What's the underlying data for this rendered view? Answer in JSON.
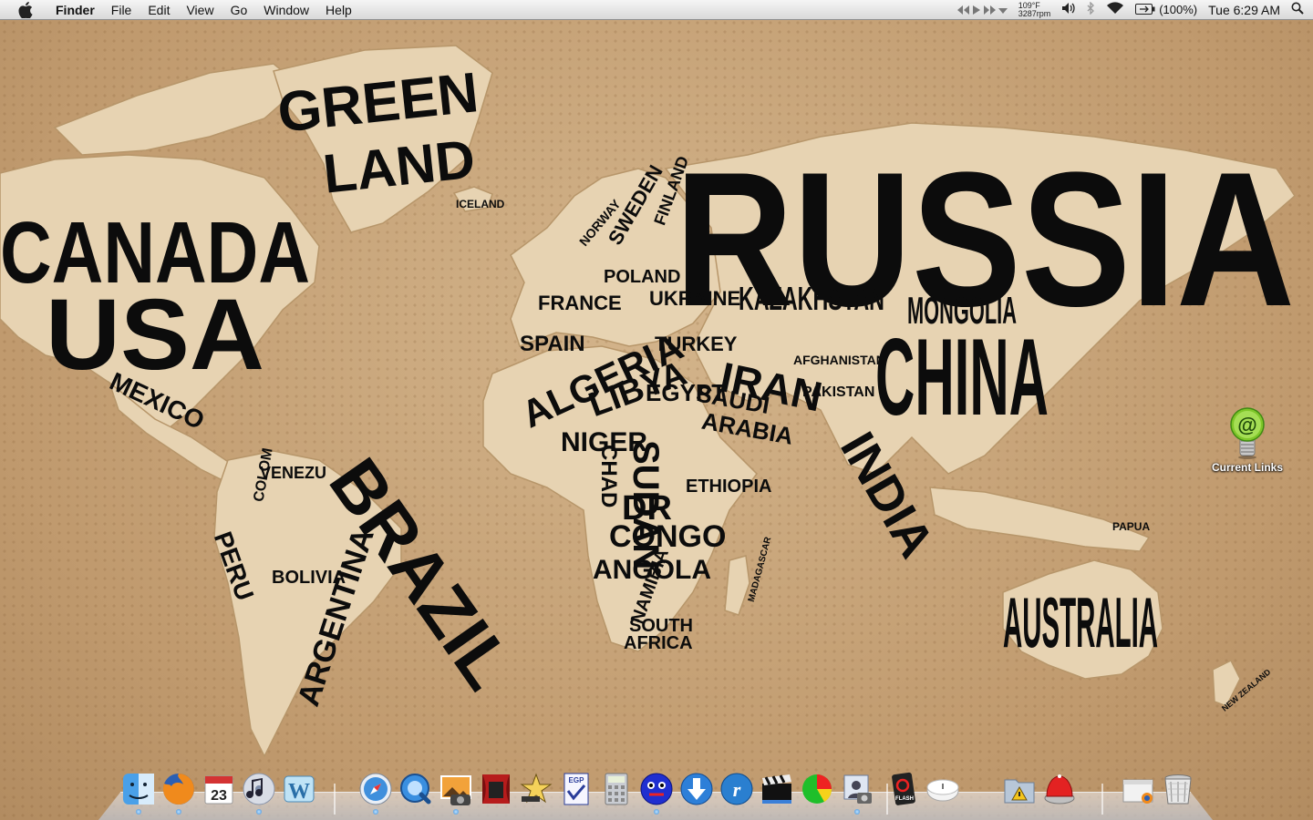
{
  "menubar": {
    "app_name": "Finder",
    "menus": [
      "File",
      "Edit",
      "View",
      "Go",
      "Window",
      "Help"
    ],
    "status": {
      "temperature": "109°F",
      "fan_speed": "3287rpm",
      "battery_percent": "(100%)",
      "clock": "Tue 6:29 AM"
    }
  },
  "map": {
    "labels": {
      "greenland_1": "GREEN",
      "greenland_2": "LAND",
      "canada": "CANADA",
      "usa": "USA",
      "mexico": "MEXICO",
      "iceland": "ICELAND",
      "russia": "RUSSIA",
      "china": "CHINA",
      "mongolia": "MONGOLIA",
      "kazakhstan": "KAZAKHSTAN",
      "brazil": "BRAZIL",
      "argentina": "ARGENTINA",
      "peru": "PERU",
      "bolivia": "BOLIVIA",
      "venezuela": "VENEZU",
      "colombia": "COLOM",
      "australia": "AUSTRALIA",
      "india": "INDIA",
      "iran": "IRAN",
      "saudi": "SAUDI",
      "arabia": "ARABIA",
      "turkey": "TURKEY",
      "libya": "LIBYA",
      "algeria": "ALGERIA",
      "egypt": "EGYPT",
      "sudan": "SUDAN",
      "niger": "NIGER",
      "chad": "CHAD",
      "dr": "DR",
      "congo": "CONGO",
      "angola": "ANGOLA",
      "namibia": "NAMIBIA",
      "south": "SOUTH",
      "africa": "AFRICA",
      "madagascar": "MADAGASCAR",
      "spain": "SPAIN",
      "france": "FRANCE",
      "poland": "POLAND",
      "ukraine": "UKRAINE",
      "sweden": "SWEDEN",
      "finland": "FINLAND",
      "norway": "NORWAY",
      "pakistan": "PAKISTAN",
      "afghanistan": "AFGHANISTAN",
      "ethiopia": "ETHIOPIA",
      "papua": "PAPUA",
      "nz": "NEW ZEALAND"
    }
  },
  "desktop_icons": [
    {
      "label": "Current Links"
    }
  ],
  "dock": {
    "items": [
      "finder-icon",
      "firefox-icon",
      "ical-icon",
      "itunes-icon",
      "wordpress-icon",
      "safari-icon",
      "quicktime-icon",
      "iphoto-icon",
      "photo-booth-icon",
      "imovie-icon",
      "egp-icon",
      "calculator-icon",
      "smiley-app-icon",
      "download-icon",
      "realplayer-icon",
      "clapper-icon",
      "chart-app-icon",
      "image-capture-icon",
      "flash-icon",
      "time-capsule-icon",
      "folder-icon",
      "flashlight-app-icon",
      "document-stack-icon",
      "trash-icon"
    ]
  },
  "colors": {
    "wallpaper": "#c7a57b",
    "land": "#e7d3b2",
    "ink": "#0c0c0c"
  }
}
